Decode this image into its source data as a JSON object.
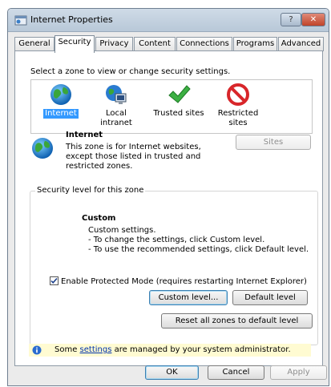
{
  "window": {
    "title": "Internet Properties",
    "help_label": "?",
    "close_label": "✕"
  },
  "tabs": [
    {
      "label": "General"
    },
    {
      "label": "Security"
    },
    {
      "label": "Privacy"
    },
    {
      "label": "Content"
    },
    {
      "label": "Connections"
    },
    {
      "label": "Programs"
    },
    {
      "label": "Advanced"
    }
  ],
  "security": {
    "zone_prompt": "Select a zone to view or change security settings.",
    "zones": [
      {
        "label": "Internet",
        "icon": "globe-icon",
        "selected": true
      },
      {
        "label": "Local intranet",
        "icon": "intranet-icon",
        "selected": false
      },
      {
        "label": "Trusted sites",
        "icon": "checkmark-icon",
        "selected": false
      },
      {
        "label_line1": "Restricted",
        "label_line2": "sites",
        "icon": "restricted-icon",
        "selected": false
      }
    ],
    "selected_zone": {
      "title": "Internet",
      "description": "This zone is for Internet websites, except those listed in trusted and restricted zones."
    },
    "sites_button": "Sites",
    "level_group_label": "Security level for this zone",
    "level_title": "Custom",
    "level_lines": [
      "Custom settings.",
      "- To change the settings, click Custom level.",
      "- To use the recommended settings, click Default level."
    ],
    "protected_mode_label": "Enable Protected Mode (requires restarting Internet Explorer)",
    "protected_mode_checked": true,
    "custom_level_button": "Custom level...",
    "default_level_button": "Default level",
    "reset_button": "Reset all zones to default level",
    "info_prefix": "Some ",
    "info_link": "settings",
    "info_suffix": " are managed by your system administrator."
  },
  "footer": {
    "ok_button": "OK",
    "cancel_button": "Cancel",
    "apply_button": "Apply"
  },
  "colors": {
    "selection": "#3399ff",
    "info_bar": "#fffbd2",
    "link": "#0033aa"
  }
}
